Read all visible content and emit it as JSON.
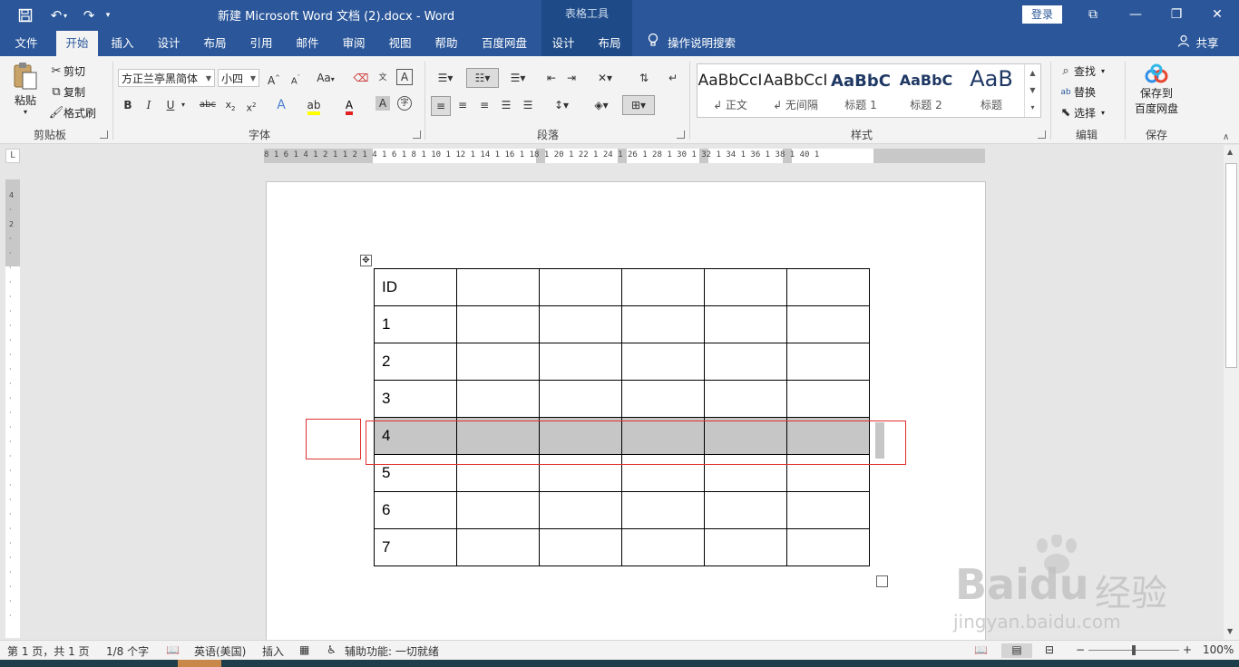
{
  "titlebar": {
    "title": "新建 Microsoft Word 文档 (2).docx  -  Word",
    "context_group": "表格工具",
    "login": "登录"
  },
  "tabs": [
    "文件",
    "开始",
    "插入",
    "设计",
    "布局",
    "引用",
    "邮件",
    "审阅",
    "视图",
    "帮助",
    "百度网盘",
    "设计",
    "布局"
  ],
  "active_tab_index": 1,
  "tell_me": "操作说明搜索",
  "share": "共享",
  "ribbon": {
    "clipboard": {
      "paste": "粘贴",
      "cut": "剪切",
      "copy": "复制",
      "format_painter": "格式刷",
      "label": "剪贴板"
    },
    "font": {
      "name": "方正兰亭黑简体",
      "size": "小四",
      "label": "字体",
      "case_btn": "Aa"
    },
    "paragraph": {
      "label": "段落"
    },
    "styles": {
      "label": "样式",
      "items": [
        {
          "sample": "AaBbCcI",
          "name": "↲ 正文"
        },
        {
          "sample": "AaBbCcI",
          "name": "↲ 无间隔"
        },
        {
          "sample": "AaBbC",
          "name": "标题 1"
        },
        {
          "sample": "AaBbC",
          "name": "标题 2"
        },
        {
          "sample": "AaB",
          "name": "标题"
        }
      ]
    },
    "editing": {
      "find": "查找",
      "replace": "替换",
      "select": "选择",
      "label": "编辑"
    },
    "save": {
      "line1": "保存到",
      "line2": "百度网盘",
      "label": "保存"
    }
  },
  "ruler": {
    "h_ticks": "8 1 6 1 4 1 2 1     1 2 1 4 1   6 1 8 1 10 1 12 1 14 1 16 1 18 1 20 1 22 1 24 1 26 1 28 1 30 1 32 1 34 1 36 1 38 1 40 1",
    "corner": "L"
  },
  "table": {
    "rows": [
      [
        "ID",
        "",
        "",
        "",
        "",
        ""
      ],
      [
        "1",
        "",
        "",
        "",
        "",
        ""
      ],
      [
        "2",
        "",
        "",
        "",
        "",
        ""
      ],
      [
        "3",
        "",
        "",
        "",
        "",
        ""
      ],
      [
        "4",
        "",
        "",
        "",
        "",
        ""
      ],
      [
        "5",
        "",
        "",
        "",
        "",
        ""
      ],
      [
        "6",
        "",
        "",
        "",
        "",
        ""
      ],
      [
        "7",
        "",
        "",
        "",
        "",
        ""
      ]
    ],
    "selected_row": 4
  },
  "status": {
    "page": "第 1 页，共 1 页",
    "words": "1/8 个字",
    "language": "英语(美国)",
    "mode": "插入",
    "accessibility": "辅助功能: 一切就绪",
    "zoom": "100%",
    "zoom_minus": "−",
    "zoom_plus": "+"
  },
  "watermark": {
    "brand": "Baidu",
    "product": "经验",
    "url": "jingyan.baidu.com"
  },
  "icons": {
    "save": "save-icon",
    "undo": "undo-icon",
    "redo": "redo-icon",
    "customize": "qat-dropdown-icon",
    "lightbulb": "lightbulb-icon",
    "share": "share-person-icon"
  },
  "colors": {
    "brand": "#2b579a",
    "context_tab": "#1e4a87",
    "selection": "#c6c6c6",
    "highlight_box": "#e03030"
  }
}
